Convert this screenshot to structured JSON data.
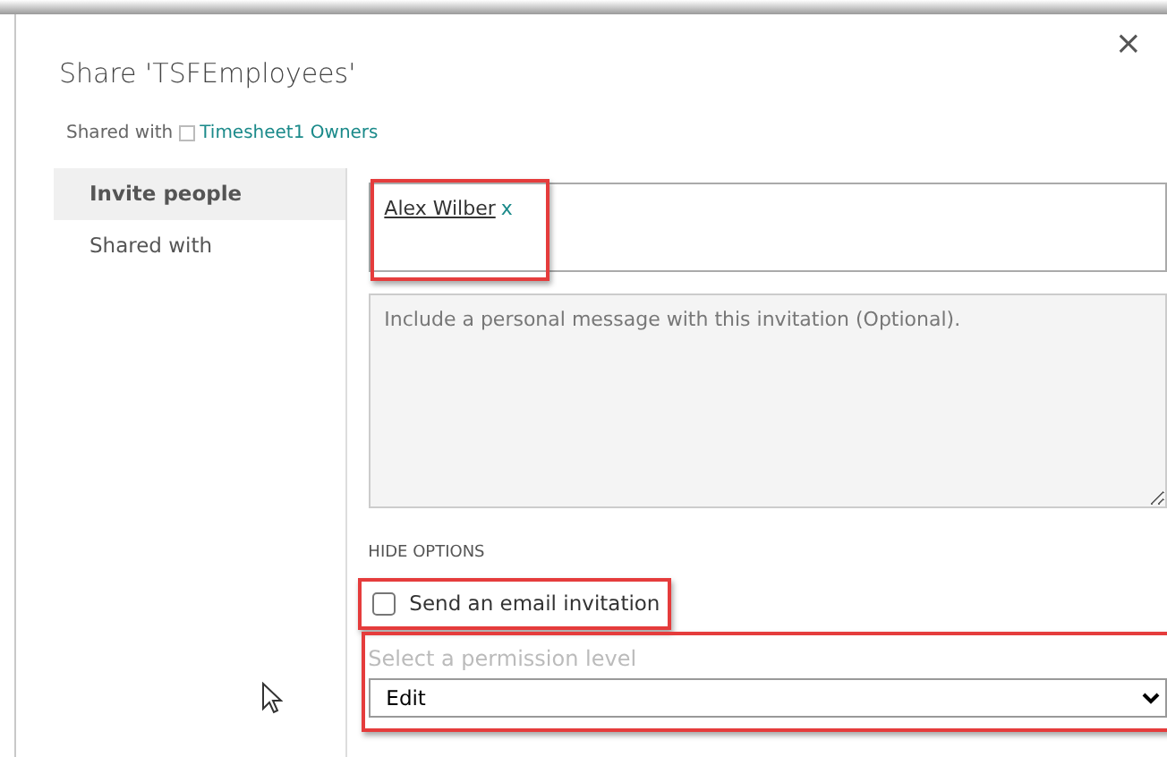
{
  "dialog": {
    "title": "Share 'TSFEmployees'",
    "close": "×"
  },
  "shared_with": {
    "label": "Shared with",
    "link": "Timesheet1 Owners"
  },
  "nav": [
    {
      "label": "Invite people",
      "selected": true
    },
    {
      "label": "Shared with",
      "selected": false
    }
  ],
  "people": {
    "name": "Alex Wilber",
    "remove": "x",
    "highlighted": true
  },
  "message": {
    "placeholder": "Include a personal message with this invitation (Optional)."
  },
  "options_toggle": "HIDE OPTIONS",
  "email_option": {
    "label": "Send an email invitation",
    "checked": false,
    "highlighted": true
  },
  "permission": {
    "label": "Select a permission level",
    "value": "Edit",
    "highlighted": true
  }
}
